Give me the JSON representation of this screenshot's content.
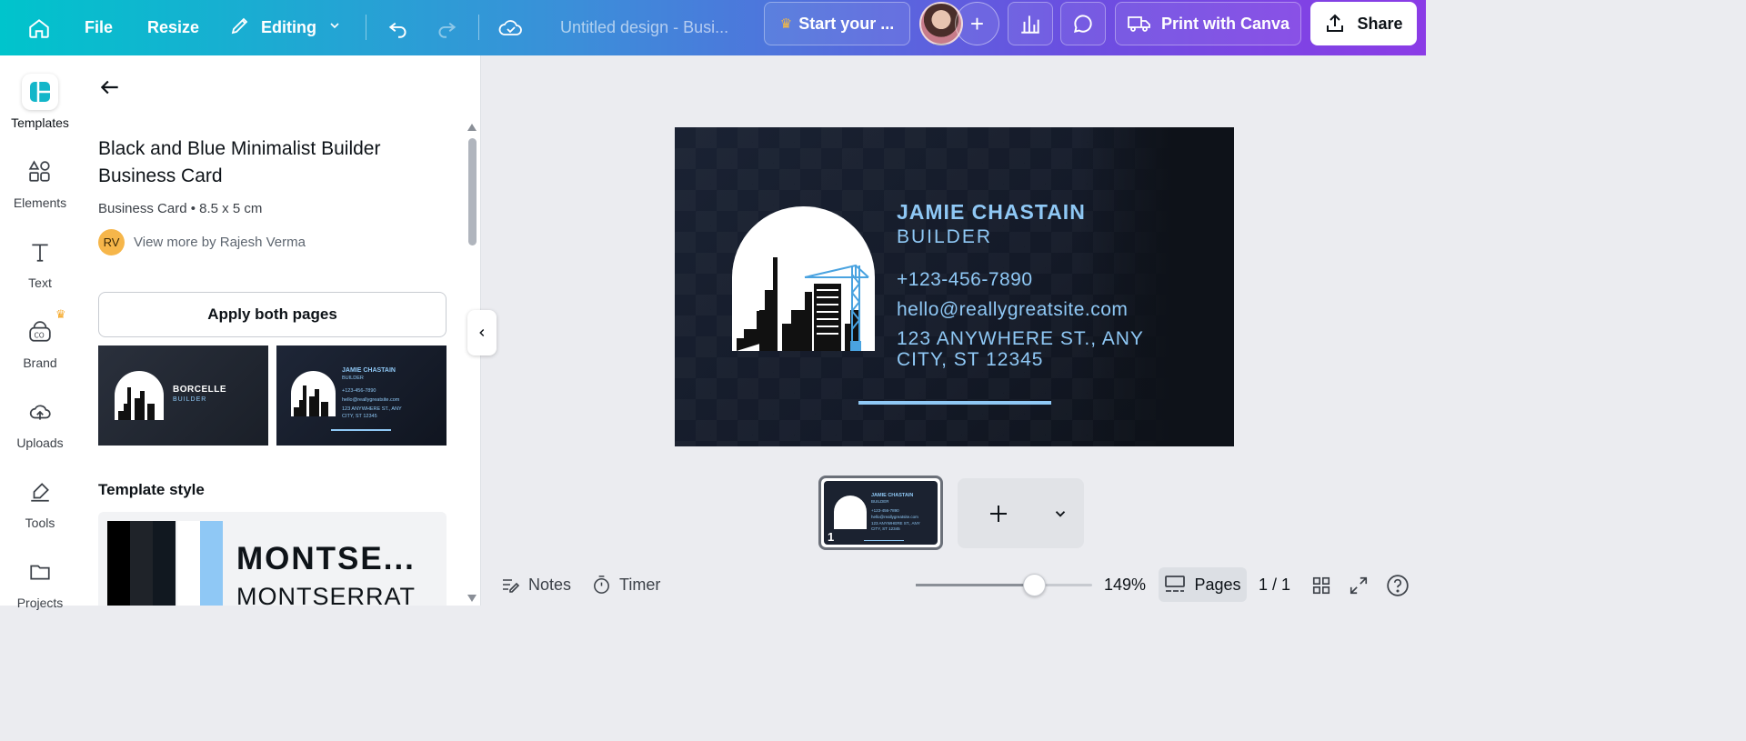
{
  "topbar": {
    "file": "File",
    "resize": "Resize",
    "editing": "Editing",
    "doc_title": "Untitled design - Busi...",
    "trial": "Start your ...",
    "print": "Print with Canva",
    "share": "Share"
  },
  "rail": {
    "items": [
      {
        "label": "Templates",
        "icon": "templates-icon"
      },
      {
        "label": "Elements",
        "icon": "elements-icon"
      },
      {
        "label": "Text",
        "icon": "text-icon"
      },
      {
        "label": "Brand",
        "icon": "brand-icon"
      },
      {
        "label": "Uploads",
        "icon": "uploads-icon"
      },
      {
        "label": "Tools",
        "icon": "tools-icon"
      },
      {
        "label": "Projects",
        "icon": "projects-icon"
      }
    ]
  },
  "panel": {
    "title": "Black and Blue Minimalist Builder Business Card",
    "meta": "Business Card • 8.5 x 5 cm",
    "author_initials": "RV",
    "author_link": "View more by Rajesh Verma",
    "apply_button": "Apply both pages",
    "thumb1": {
      "name": "BORCELLE",
      "role": "BUILDER"
    },
    "thumb2": {
      "name": "JAMIE CHASTAIN",
      "role": "BUILDER",
      "phone": "+123-456-7890",
      "email": "hello@reallygreatsite.com",
      "addr1": "123 ANYWHERE ST., ANY",
      "addr2": "CITY, ST 12345"
    },
    "style_heading": "Template style",
    "font_heading": "MONTSE...",
    "font_body": "MONTSERRAT",
    "swatches": [
      "#000000",
      "#1f2329",
      "#111820",
      "#ffffff",
      "#8fc8f5"
    ]
  },
  "card": {
    "name": "JAMIE CHASTAIN",
    "role": "BUILDER",
    "phone": "+123-456-7890",
    "email": "hello@reallygreatsite.com",
    "address_line1": "123 ANYWHERE ST., ANY",
    "address_line2": "CITY, ST 12345",
    "accent": "#8fc8f5"
  },
  "pages_strip": {
    "page_number": "1"
  },
  "bottombar": {
    "notes": "Notes",
    "timer": "Timer",
    "zoom": "149%",
    "zoom_level": 0.67,
    "pages": "Pages",
    "page_count": "1 / 1"
  }
}
